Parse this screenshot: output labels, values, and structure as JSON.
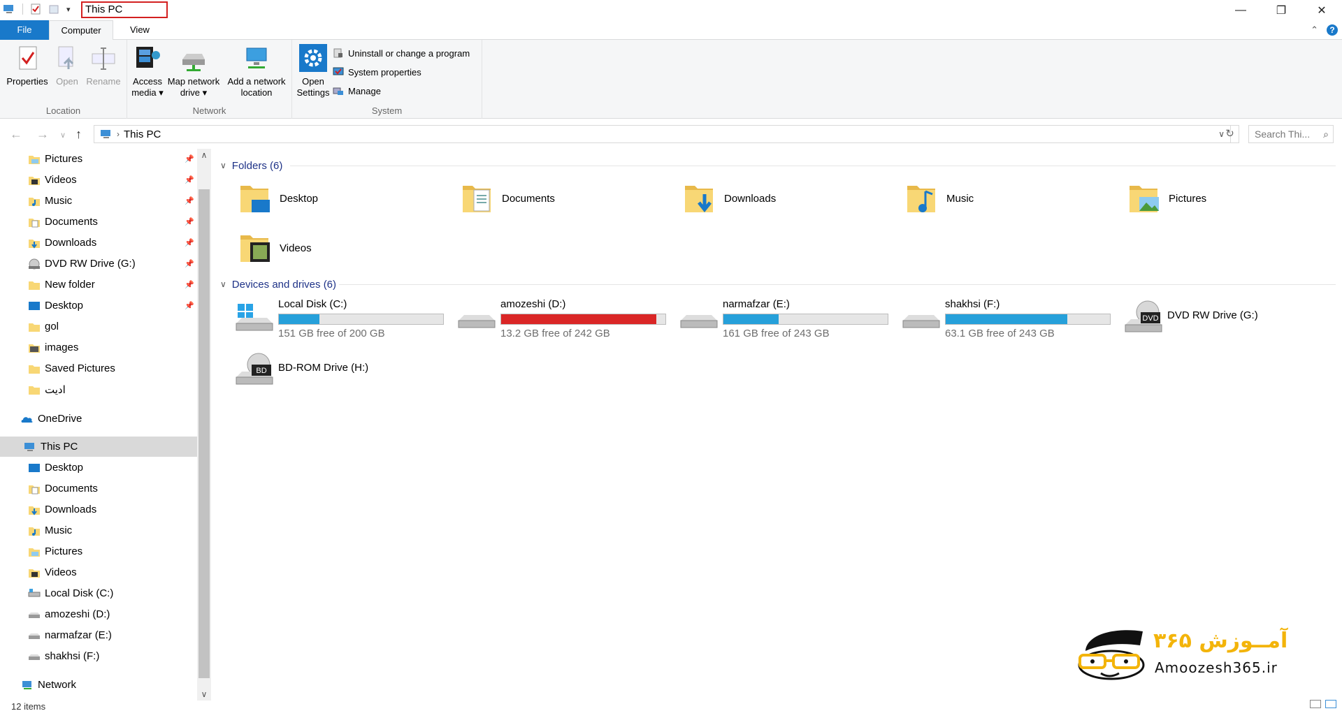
{
  "window": {
    "title": "This PC"
  },
  "ribbon": {
    "tabs": [
      {
        "label": "File"
      },
      {
        "label": "Computer"
      },
      {
        "label": "View"
      }
    ],
    "groups": {
      "location": {
        "label": "Location",
        "buttons": [
          {
            "label": "Properties"
          },
          {
            "label": "Open"
          },
          {
            "label": "Rename"
          }
        ]
      },
      "network": {
        "label": "Network",
        "buttons": [
          {
            "label_line1": "Access",
            "label_line2": "media ▾"
          },
          {
            "label_line1": "Map network",
            "label_line2": "drive ▾"
          },
          {
            "label_line1": "Add a network",
            "label_line2": "location"
          }
        ]
      },
      "system": {
        "label": "System",
        "open_settings_line1": "Open",
        "open_settings_line2": "Settings",
        "small_buttons": [
          {
            "label": "Uninstall or change a program"
          },
          {
            "label": "System properties"
          },
          {
            "label": "Manage"
          }
        ]
      }
    }
  },
  "address": {
    "path": "This PC",
    "search_placeholder": "Search Thi..."
  },
  "navpane": {
    "quick_access": [
      {
        "label": "Pictures",
        "icon": "pictures-folder-icon",
        "pinned": true
      },
      {
        "label": "Videos",
        "icon": "videos-folder-icon",
        "pinned": true
      },
      {
        "label": "Music",
        "icon": "music-folder-icon",
        "pinned": true
      },
      {
        "label": "Documents",
        "icon": "documents-folder-icon",
        "pinned": true
      },
      {
        "label": "Downloads",
        "icon": "downloads-folder-icon",
        "pinned": true
      },
      {
        "label": "DVD RW Drive (G:)",
        "icon": "dvd-drive-icon",
        "pinned": true
      },
      {
        "label": "New folder",
        "icon": "folder-icon",
        "pinned": true
      },
      {
        "label": "Desktop",
        "icon": "desktop-folder-icon",
        "pinned": true
      },
      {
        "label": "gol",
        "icon": "folder-icon",
        "pinned": false
      },
      {
        "label": "images",
        "icon": "images-folder-icon",
        "pinned": false
      },
      {
        "label": "Saved Pictures",
        "icon": "folder-icon",
        "pinned": false
      },
      {
        "label": "ادیت",
        "icon": "folder-icon",
        "pinned": false
      }
    ],
    "onedrive": "OneDrive",
    "this_pc": "This PC",
    "this_pc_children": [
      {
        "label": "Desktop"
      },
      {
        "label": "Documents"
      },
      {
        "label": "Downloads"
      },
      {
        "label": "Music"
      },
      {
        "label": "Pictures"
      },
      {
        "label": "Videos"
      },
      {
        "label": "Local Disk (C:)"
      },
      {
        "label": "amozeshi (D:)"
      },
      {
        "label": "narmafzar (E:)"
      },
      {
        "label": "shakhsi (F:)"
      }
    ],
    "network": "Network"
  },
  "content": {
    "folders_header": "Folders (6)",
    "folders": [
      {
        "label": "Desktop"
      },
      {
        "label": "Documents"
      },
      {
        "label": "Downloads"
      },
      {
        "label": "Music"
      },
      {
        "label": "Pictures"
      },
      {
        "label": "Videos"
      }
    ],
    "drives_header": "Devices and drives (6)",
    "drives": [
      {
        "label": "Local Disk (C:)",
        "free": "151 GB free of 200 GB",
        "used_fraction": 0.245,
        "critical": false
      },
      {
        "label": "amozeshi (D:)",
        "free": "13.2 GB free of 242 GB",
        "used_fraction": 0.945,
        "critical": true
      },
      {
        "label": "narmafzar (E:)",
        "free": "161 GB free of 243 GB",
        "used_fraction": 0.337,
        "critical": false
      },
      {
        "label": "shakhsi (F:)",
        "free": "63.1 GB free of 243 GB",
        "used_fraction": 0.74,
        "critical": false
      }
    ],
    "optical": [
      {
        "label": "DVD RW Drive (G:)",
        "badge": "DVD"
      },
      {
        "label": "BD-ROM Drive (H:)",
        "badge": "BD"
      }
    ]
  },
  "status": {
    "items": "12 items"
  },
  "watermark": {
    "persian": "آمــوزش ۳۶۵",
    "latin": "Amoozesh365.ir"
  },
  "colors": {
    "accent": "#1979ca",
    "bar_normal": "#26a0da",
    "bar_critical": "#da2626",
    "section_header": "#1e3287"
  }
}
